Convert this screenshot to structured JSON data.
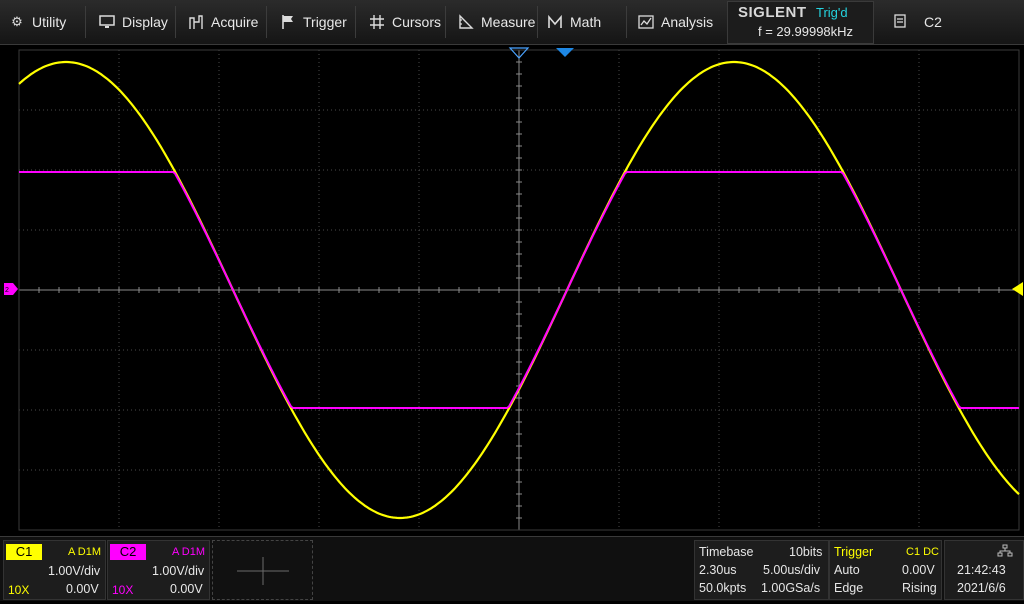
{
  "menu": {
    "utility": "Utility",
    "display": "Display",
    "acquire": "Acquire",
    "trigger": "Trigger",
    "cursors": "Cursors",
    "measure": "Measure",
    "math": "Math",
    "analysis": "Analysis"
  },
  "status": {
    "brand": "SIGLENT",
    "trigger_state": "Trig'd",
    "frequency": "f = 29.99998kHz"
  },
  "channel_select": {
    "label": "C2"
  },
  "channels": [
    {
      "tag": "C1",
      "coupling": "A D1M",
      "scale": "1.00V/div",
      "probe": "10X",
      "offset": "0.00V",
      "color": "#ffff00"
    },
    {
      "tag": "C2",
      "coupling": "A D1M",
      "scale": "1.00V/div",
      "probe": "10X",
      "offset": "0.00V",
      "color": "#ff00ff"
    }
  ],
  "timebase": {
    "label": "Timebase",
    "bits": "10bits",
    "delay": "2.30us",
    "scale": "5.00us/div",
    "points": "50.0kpts",
    "sample_rate": "1.00GSa/s"
  },
  "trigger": {
    "label": "Trigger",
    "source": "C1 DC",
    "mode": "Auto",
    "level": "0.00V",
    "type": "Edge",
    "slope": "Rising"
  },
  "clock": {
    "time": "21:42:43",
    "date": "2021/6/6"
  },
  "colors": {
    "ch1": "#ffff00",
    "ch2": "#ff00ff",
    "trigger_marker": "#1e88e5",
    "accent": "#25d4e0"
  }
}
